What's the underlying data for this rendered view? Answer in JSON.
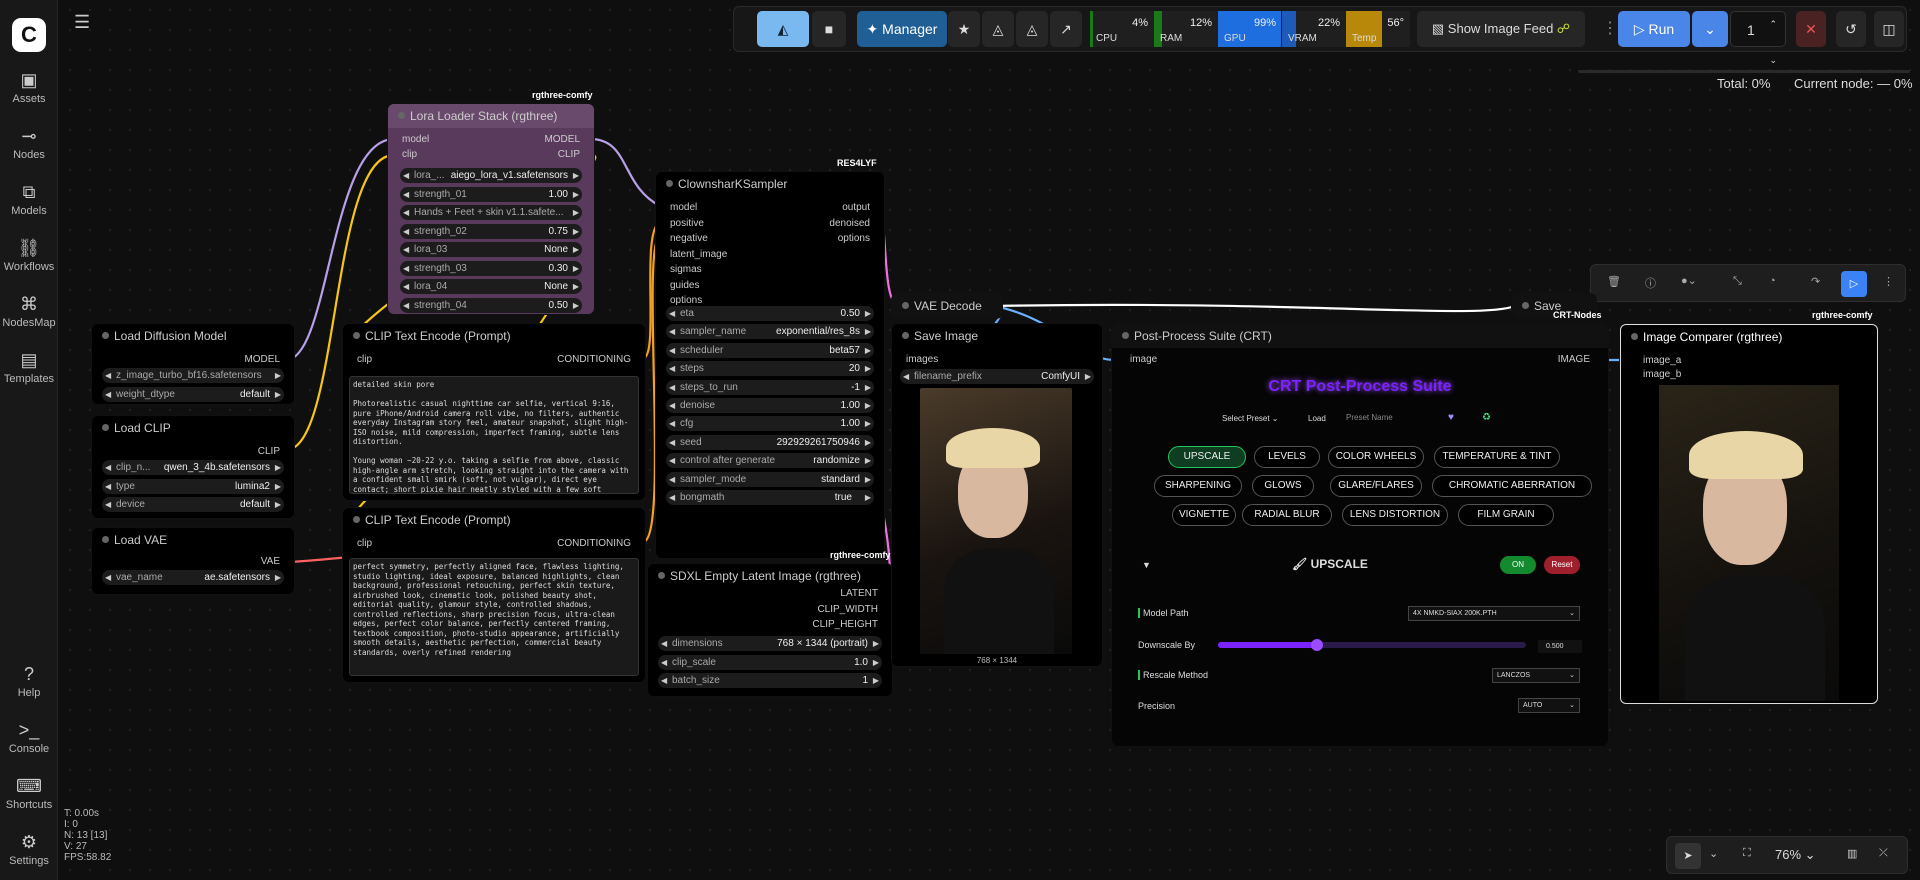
{
  "sidebar": {
    "items": [
      {
        "label": "Assets",
        "icon": "image-icon"
      },
      {
        "label": "Nodes",
        "icon": "nodes-icon"
      },
      {
        "label": "Models",
        "icon": "cubes-icon"
      },
      {
        "label": "Workflows",
        "icon": "workflow-icon"
      },
      {
        "label": "NodesMap",
        "icon": "sitemap-icon"
      },
      {
        "label": "Templates",
        "icon": "template-icon"
      }
    ],
    "bottom": [
      {
        "label": "Help",
        "icon": "help-icon"
      },
      {
        "label": "Console",
        "icon": "terminal-icon"
      },
      {
        "label": "Shortcuts",
        "icon": "keyboard-icon"
      },
      {
        "label": "Settings",
        "icon": "gear-icon"
      }
    ]
  },
  "topbar": {
    "manager": "Manager",
    "show_feed": "Show Image Feed",
    "run": "Run",
    "queue_count": "1",
    "meters": [
      {
        "name": "CPU",
        "value": "4%",
        "color": "#1a7a1a",
        "level": 0.04
      },
      {
        "name": "RAM",
        "value": "12%",
        "color": "#1a7a1a",
        "level": 0.12
      },
      {
        "name": "GPU",
        "value": "99%",
        "color": "#1e6ee0",
        "level": 0.99
      },
      {
        "name": "VRAM",
        "value": "22%",
        "color": "#1e5ab8",
        "level": 0.22
      },
      {
        "name": "Temp",
        "value": "56°",
        "color": "#b8880a",
        "level": 0.56
      }
    ]
  },
  "progress": {
    "total": "Total: 0%",
    "current": "Current node: — 0%"
  },
  "stats": {
    "t": "T: 0.00s",
    "i": "I: 0",
    "n": "N: 13 [13]",
    "v": "V: 27",
    "fps": "FPS:58.82"
  },
  "zoom": "76%",
  "nodes": {
    "lora": {
      "title": "Lora Loader Stack (rgthree)",
      "tag": "rgthree-comfy",
      "in_model": "model",
      "in_clip": "clip",
      "out_model": "MODEL",
      "out_clip": "CLIP",
      "widgets": [
        [
          "lora_...",
          "aiego_lora_v1.safetensors"
        ],
        [
          "strength_01",
          "1.00"
        ],
        [
          "Hands + Feet + skin v1.1.safete...",
          ""
        ],
        [
          "strength_02",
          "0.75"
        ],
        [
          "lora_03",
          "None"
        ],
        [
          "strength_03",
          "0.30"
        ],
        [
          "lora_04",
          "None"
        ],
        [
          "strength_04",
          "0.50"
        ]
      ]
    },
    "diffusion": {
      "title": "Load Diffusion Model",
      "out": "MODEL",
      "widgets": [
        [
          "z_image_turbo_bf16.safetensors",
          ""
        ],
        [
          "weight_dtype",
          "default"
        ]
      ]
    },
    "clip": {
      "title": "Load CLIP",
      "out": "CLIP",
      "widgets": [
        [
          "clip_n...",
          "qwen_3_4b.safetensors"
        ],
        [
          "type",
          "lumina2"
        ],
        [
          "device",
          "default"
        ]
      ]
    },
    "vae": {
      "title": "Load VAE",
      "out": "VAE",
      "widgets": [
        [
          "vae_name",
          "ae.safetensors"
        ]
      ]
    },
    "clip_pos": {
      "title": "CLIP Text Encode (Prompt)",
      "in": "clip",
      "out": "CONDITIONING",
      "text": "detailed skin pore\n\nPhotorealistic casual nighttime car selfie, vertical 9:16, pure iPhone/Android camera roll vibe, no filters, authentic everyday Instagram story feel, amateur snapshot, slight high-ISO noise, mild compression, imperfect framing, subtle lens distortion.\n\nYoung woman ~20-22 y.o. taking a selfie from above, classic high-angle arm stretch, looking straight into the camera with a confident small smirk (soft, not vulgar), direct eye contact; short pixie hair neatly styled with a few soft strands, realistic flyaway hairs. Natural makeup with emphasis on the eyes (defined lashes, subtle eyeliner), glossy nude-pink lips, realistic skin"
    },
    "clip_neg": {
      "title": "CLIP Text Encode (Prompt)",
      "in": "clip",
      "out": "CONDITIONING",
      "text": "perfect symmetry, perfectly aligned face, flawless lighting, studio lighting, ideal exposure, balanced highlights, clean background, professional retouching, perfect skin texture, airbrushed look, cinematic look, polished beauty shot, editorial quality, glamour style, controlled shadows, controlled reflections, sharp precision focus, ultra-clean edges, perfect color balance, perfectly centered framing, textbook composition, photo-studio appearance, artificially smooth details, aesthetic perfection, commercial beauty standards, overly refined rendering"
    },
    "sampler": {
      "title": "ClownsharKSampler",
      "tag": "RES4LYF",
      "inputs": [
        "model",
        "positive",
        "negative",
        "latent_image",
        "sigmas",
        "guides",
        "options"
      ],
      "outputs": [
        "output",
        "denoised",
        "options"
      ],
      "widgets": [
        [
          "eta",
          "0.50"
        ],
        [
          "sampler_name",
          "exponential/res_8s"
        ],
        [
          "scheduler",
          "beta57"
        ],
        [
          "steps",
          "20"
        ],
        [
          "steps_to_run",
          "-1"
        ],
        [
          "denoise",
          "1.00"
        ],
        [
          "cfg",
          "1.00"
        ],
        [
          "seed",
          "292929261750946"
        ],
        [
          "control after generate",
          "randomize"
        ],
        [
          "sampler_mode",
          "standard"
        ]
      ],
      "bongmath": "bongmath",
      "bongmath_val": "true"
    },
    "latent": {
      "title": "SDXL Empty Latent Image (rgthree)",
      "tag": "rgthree-comfy",
      "outputs": [
        "LATENT",
        "CLIP_WIDTH",
        "CLIP_HEIGHT"
      ],
      "widgets": [
        [
          "dimensions",
          "768 × 1344  (portrait)"
        ],
        [
          "clip_scale",
          "1.0"
        ],
        [
          "batch_size",
          "1"
        ]
      ]
    },
    "vaedecode": {
      "title": "VAE Decode"
    },
    "save": {
      "title": "Save Image",
      "in": "images",
      "prefix_label": "filename_prefix",
      "prefix": "ComfyUI",
      "caption": "768 × 1344"
    },
    "saveimg2": {
      "title": "Save Image",
      "tag": "CRT-Nodes"
    },
    "crt": {
      "title": "Post-Process Suite (CRT)",
      "in": "image",
      "out": "IMAGE",
      "heading": "CRT Post-Process Suite",
      "select_preset": "Select Preset",
      "load": "Load",
      "preset_name": "Preset Name",
      "pills": [
        "UPSCALE",
        "LEVELS",
        "COLOR WHEELS",
        "TEMPERATURE & TINT",
        "SHARPENING",
        "GLOWS",
        "GLARE/FLARES",
        "CHROMATIC ABERRATION",
        "VIGNETTE",
        "RADIAL BLUR",
        "LENS DISTORTION",
        "FILM GRAIN"
      ],
      "section": "UPSCALE",
      "on": "ON",
      "reset": "Reset",
      "model_path_label": "Model Path",
      "model_path": "4X NMKD-SIAX 200K.PTH",
      "downscale_label": "Downscale By",
      "downscale": "0.500",
      "downscale_level": 0.32,
      "rescale_label": "Rescale Method",
      "rescale": "LANCZOS",
      "precision_label": "Precision",
      "precision": "AUTO"
    },
    "comparer": {
      "title": "Image Comparer (rgthree)",
      "tag": "rgthree-comfy",
      "a": "image_a",
      "b": "image_b"
    }
  }
}
